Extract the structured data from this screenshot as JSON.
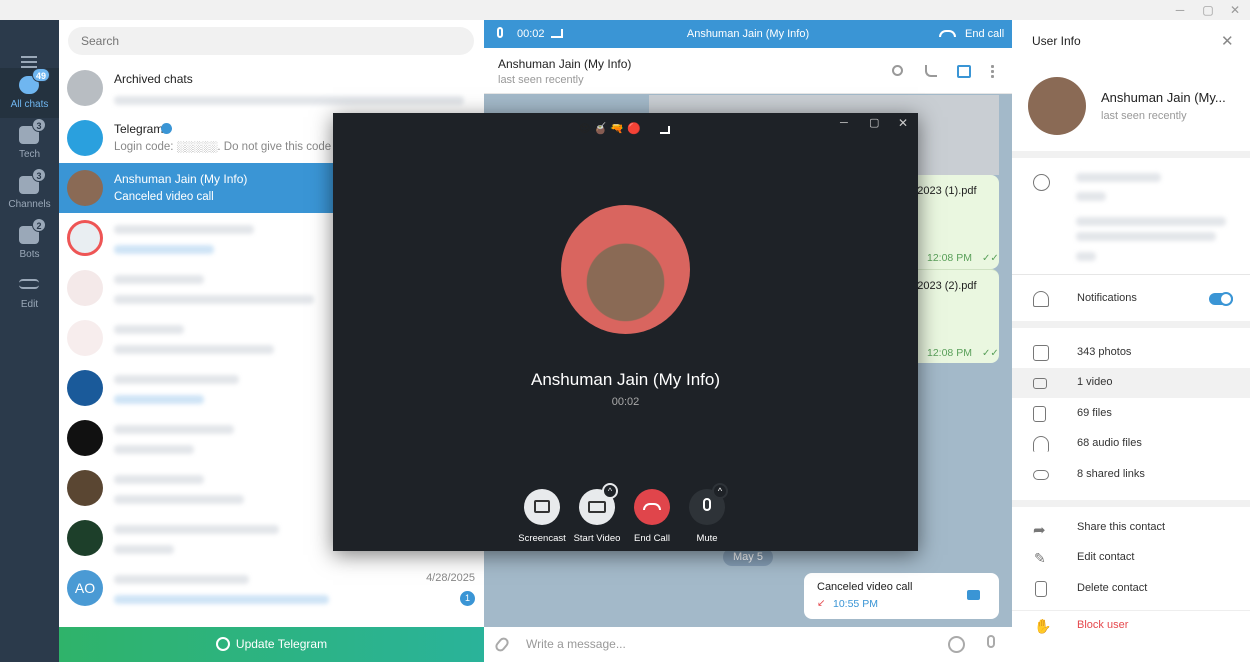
{
  "folders": [
    {
      "label": "All chats",
      "badge": "49"
    },
    {
      "label": "Tech",
      "badge": "3"
    },
    {
      "label": "Channels",
      "badge": "3"
    },
    {
      "label": "Bots",
      "badge": "2"
    },
    {
      "label": "Edit",
      "badge": ""
    }
  ],
  "chatlist": {
    "search_placeholder": "Search",
    "archived": "Archived chats",
    "telegram_name": "Telegram",
    "telegram_preview": "Login code: ░░░░░. Do not give this code to a",
    "selected_name": "Anshuman Jain (My Info)",
    "selected_preview": "Canceled video call",
    "ao_initials": "AO",
    "ao_time": "4/28/2025",
    "ao_unread": "1",
    "update_label": "Update Telegram"
  },
  "callbar": {
    "timer": "00:02",
    "title": "Anshuman Jain (My Info)",
    "end": "End call"
  },
  "header": {
    "name": "Anshuman Jain (My Info)",
    "status": "last seen recently"
  },
  "messages": {
    "file1": "ot 2023 (1).pdf",
    "file1_time": "12:08 PM",
    "file2": "ot 2023 (2).pdf",
    "file2_time": "12:08 PM",
    "date_chip": "May 5",
    "canceled": "Canceled video call",
    "canceled_time": "10:55 PM",
    "composer_placeholder": "Write a message..."
  },
  "call": {
    "name": "Anshuman Jain (My Info)",
    "timer": "00:02",
    "emojis": "😍 🧉 🔫 🔴",
    "buttons": [
      "Screencast",
      "Start Video",
      "End Call",
      "Mute"
    ]
  },
  "info": {
    "title": "User Info",
    "name": "Anshuman Jain (My...",
    "status": "last seen recently",
    "notifications": "Notifications",
    "notifications_on": true,
    "media": [
      "343 photos",
      "1 video",
      "69 files",
      "68 audio files",
      "8 shared links"
    ],
    "actions": [
      "Share this contact",
      "Edit contact",
      "Delete contact"
    ],
    "block": "Block user"
  },
  "colors": {
    "accent": "#3a95d5",
    "sidebar": "#2b3a4b",
    "end_call": "#e0454b",
    "update_green": "#2fb36a",
    "block_red": "#e5484d"
  }
}
